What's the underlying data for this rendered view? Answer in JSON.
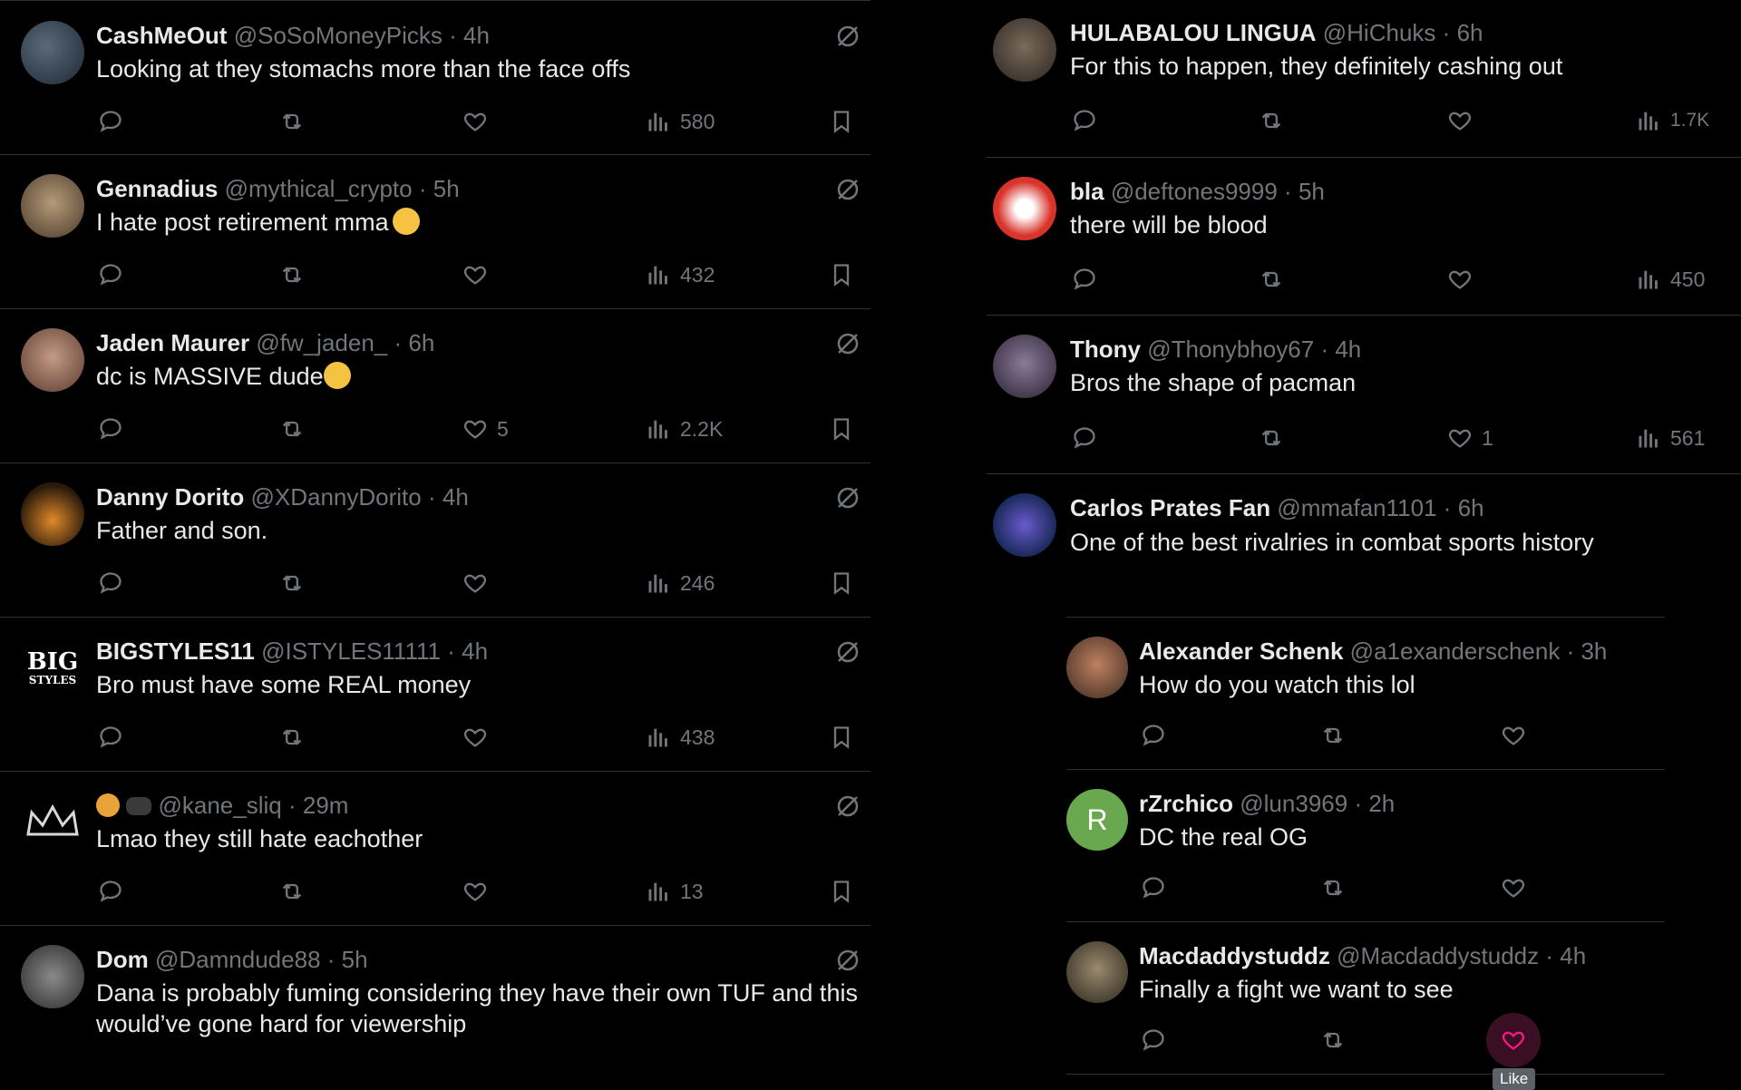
{
  "left_column": {
    "tweets": [
      {
        "name": "CashMeOut",
        "handle": "@SoSoMoneyPicks",
        "time": "4h",
        "text": "Looking at they stomachs more than the face offs",
        "likes": "",
        "views": "580"
      },
      {
        "name": "Gennadius",
        "handle": "@mythical_crypto",
        "time": "5h",
        "text": "I hate post retirement mma",
        "likes": "",
        "views": "432"
      },
      {
        "name": "Jaden Maurer",
        "handle": "@fw_jaden_",
        "time": "6h",
        "text": "dc is MASSIVE dude",
        "likes": "5",
        "views": "2.2K"
      },
      {
        "name": "Danny Dorito",
        "handle": "@XDannyDorito",
        "time": "4h",
        "text": "Father and son.",
        "likes": "",
        "views": "246"
      },
      {
        "name": "BIGSTYLES11",
        "handle": "@ISTYLES11111",
        "time": "4h",
        "text": "Bro must have some REAL money",
        "likes": "",
        "views": "438",
        "avatar_text_top": "BIG",
        "avatar_text_bottom": "STYLES"
      },
      {
        "name": "",
        "handle": "@kane_sliq",
        "time": "29m",
        "text": "Lmao they still hate eachother",
        "likes": "",
        "views": "13"
      },
      {
        "name": "Dom",
        "handle": "@Damndude88",
        "time": "5h",
        "text": "Dana is probably fuming considering they have their own TUF and this\nwould’ve gone hard for viewership",
        "likes": "",
        "views": ""
      }
    ]
  },
  "right_column": {
    "tweets": [
      {
        "name": "HULABALOU LINGUA",
        "handle": "@HiChuks",
        "time": "6h",
        "text": "For this to happen, they definitely cashing out",
        "likes": "",
        "views": "1.7K"
      },
      {
        "name": "bla",
        "handle": "@deftones9999",
        "time": "5h",
        "text": "there will be blood",
        "likes": "",
        "views": "450"
      },
      {
        "name": "Thony",
        "handle": "@Thonybhoy67",
        "time": "4h",
        "text": "Bros the shape of pacman",
        "likes": "1",
        "views": "561"
      },
      {
        "name": "Carlos Prates Fan",
        "handle": "@mmafan1101",
        "time": "6h",
        "text": "One of the best rivalries in combat sports history"
      }
    ],
    "replies": [
      {
        "name": "Alexander Schenk",
        "handle": "@a1exanderschenk",
        "time": "3h",
        "text": "How do you watch this lol"
      },
      {
        "name": "rZrchico",
        "handle": "@lun3969",
        "time": "2h",
        "text": "DC the real OG",
        "avatar_letter": "R"
      },
      {
        "name": "Macdaddystuddz",
        "handle": "@Macdaddystuddz",
        "time": "4h",
        "text": "Finally a fight we want to see"
      }
    ]
  },
  "separator": "·",
  "tooltip": "Like",
  "colors": {
    "background": "#000000",
    "text": "#e7e9ea",
    "muted": "#71767b",
    "border": "#2f3336",
    "like_active": "#f91880",
    "rzrchico_avatar": "#6aa84f"
  }
}
